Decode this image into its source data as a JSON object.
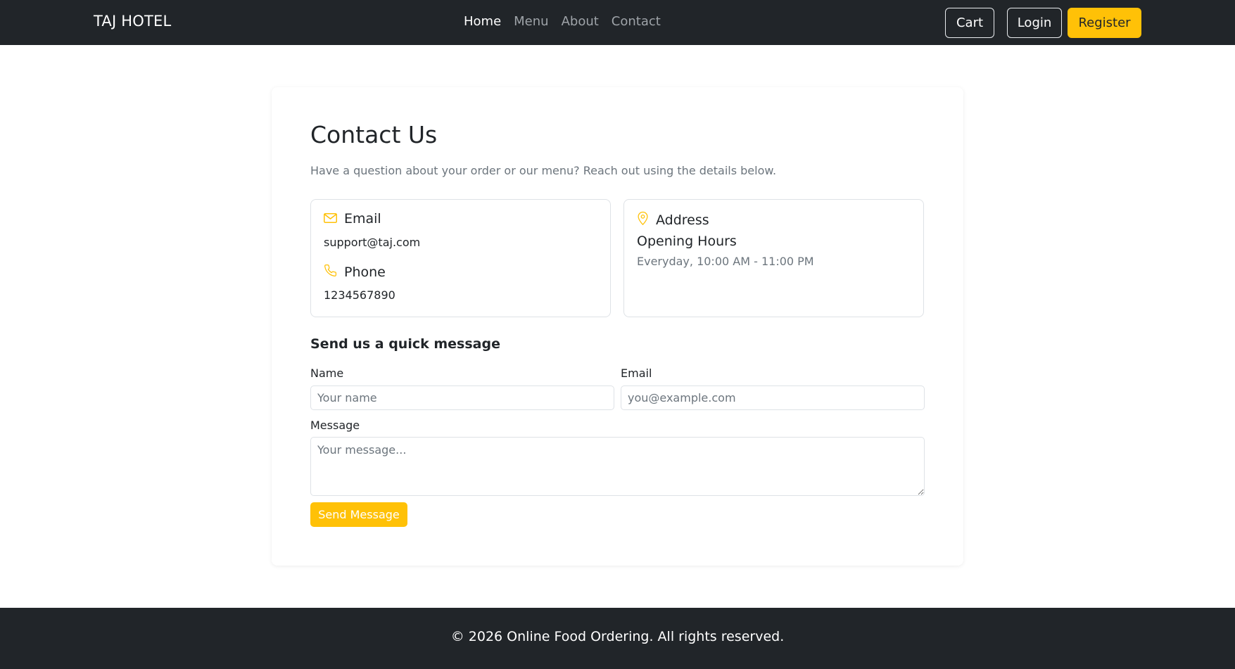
{
  "navbar": {
    "brand": "TAJ HOTEL",
    "links": [
      {
        "label": "Home",
        "active": true
      },
      {
        "label": "Menu",
        "active": false
      },
      {
        "label": "About",
        "active": false
      },
      {
        "label": "Contact",
        "active": false
      }
    ],
    "cart_label": "Cart",
    "login_label": "Login",
    "register_label": "Register"
  },
  "contact": {
    "title": "Contact Us",
    "subtitle": "Have a question about your order or our menu? Reach out using the details below.",
    "email_label": "Email",
    "email_value": "support@taj.com",
    "phone_label": "Phone",
    "phone_value": "1234567890",
    "address_label": "Address",
    "hours_label": "Opening Hours",
    "hours_value": "Everyday, 10:00 AM - 11:00 PM"
  },
  "form": {
    "heading": "Send us a quick message",
    "name_label": "Name",
    "name_placeholder": "Your name",
    "email_label": "Email",
    "email_placeholder": "you@example.com",
    "message_label": "Message",
    "message_placeholder": "Your message...",
    "submit_label": "Send Message"
  },
  "footer": {
    "text": "© 2026 Online Food Ordering. All rights reserved."
  },
  "colors": {
    "navbar_bg": "#212529",
    "accent": "#ffc107",
    "nav_inactive": "#9ea3a8"
  },
  "icons": {
    "email": "envelope-icon",
    "phone": "phone-icon",
    "address": "map-pin-icon"
  }
}
